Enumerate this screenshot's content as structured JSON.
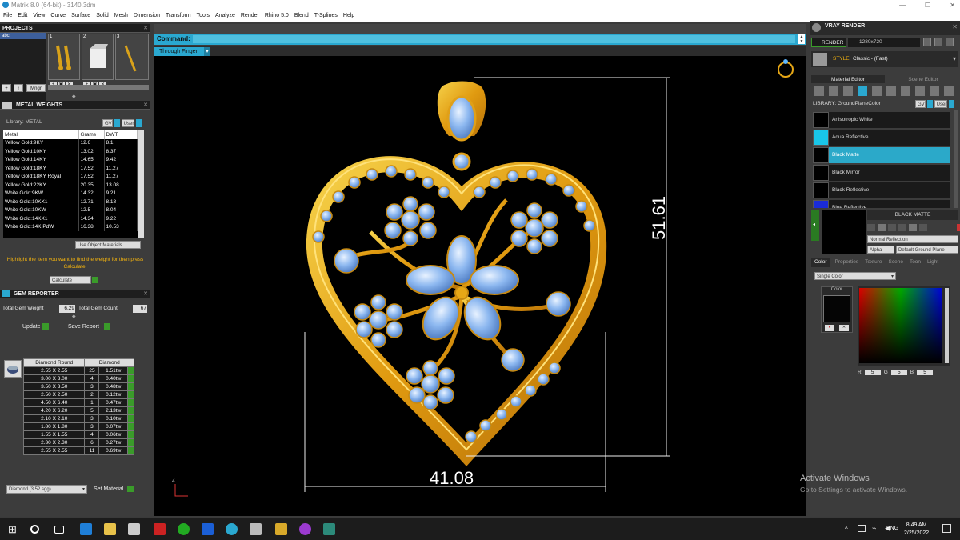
{
  "titlebar": {
    "title": "Matrix 8.0 (64-bit) - 3140.3dm",
    "minimize": "—",
    "maximize": "❐",
    "close": "✕"
  },
  "menu": [
    "File",
    "Edit",
    "View",
    "Curve",
    "Surface",
    "Solid",
    "Mesh",
    "Dimension",
    "Transform",
    "Tools",
    "Analyze",
    "Render",
    "Rhino 5.0",
    "Blend",
    "T-Splines",
    "Help"
  ],
  "projects": {
    "header": "PROJECTS",
    "selected": "abc",
    "thumbs": [
      "1",
      "2",
      "3"
    ],
    "buttons": {
      "plus": "+",
      "up": "↑",
      "manager": "Mngr"
    }
  },
  "metal": {
    "header": "METAL WEIGHTS",
    "library": "Library: METAL",
    "gv": "GV",
    "user": "User",
    "columns": [
      "Metal",
      "Grams",
      "DWT"
    ],
    "rows": [
      [
        "Yellow Gold:9KY",
        "12.6",
        "8.1"
      ],
      [
        "Yellow Gold:10KY",
        "13.02",
        "8.37"
      ],
      [
        "Yellow Gold:14KY",
        "14.65",
        "9.42"
      ],
      [
        "Yellow Gold:18KY",
        "17.52",
        "11.27"
      ],
      [
        "Yellow Gold:18KY Royal",
        "17.52",
        "11.27"
      ],
      [
        "Yellow Gold:22KY",
        "20.35",
        "13.08"
      ],
      [
        "White Gold:9KW",
        "14.32",
        "9.21"
      ],
      [
        "White Gold:10KX1",
        "12.71",
        "8.18"
      ],
      [
        "White Gold:10KW",
        "12.5",
        "8.04"
      ],
      [
        "White Gold:14KX1",
        "14.34",
        "9.22"
      ],
      [
        "White Gold:14K PdW",
        "16.38",
        "10.53"
      ]
    ],
    "use_object": "Use Object Materials",
    "hint": "Highlight the item you want to find the weight for then press Calculate.",
    "calculate": "Calculate"
  },
  "gems": {
    "header": "GEM REPORTER",
    "total_weight_label": "Total Gem Weight",
    "total_weight": "6.29",
    "total_count_label": "Total Gem Count",
    "total_count": "67",
    "update": "Update",
    "save_report": "Save Report",
    "col1": "Diamond Round",
    "col2": "Diamond",
    "rows": [
      [
        "2.55 X 2.55",
        "25",
        "1.51tw"
      ],
      [
        "3.00 X 3.00",
        "4",
        "0.40tw"
      ],
      [
        "3.50 X 3.50",
        "3",
        "0.48tw"
      ],
      [
        "2.50 X 2.50",
        "2",
        "0.12tw"
      ],
      [
        "4.50 X 6.40",
        "1",
        "0.47tw"
      ],
      [
        "4.20 X 6.20",
        "5",
        "2.13tw"
      ],
      [
        "2.10 X 2.10",
        "3",
        "0.10tw"
      ],
      [
        "1.80 X 1.80",
        "3",
        "0.07tw"
      ],
      [
        "1.55 X 1.55",
        "4",
        "0.06tw"
      ],
      [
        "2.30 X 2.30",
        "6",
        "0.27tw"
      ],
      [
        "2.55 X 2.55",
        "11",
        "0.69tw"
      ]
    ],
    "material_select": "Diamond    (3.52 sgg)",
    "set_material": "Set Material"
  },
  "command": {
    "label": "Command:",
    "value": ""
  },
  "viewport": {
    "mode": "Through Finger",
    "dim_height": "51.61",
    "dim_width": "41.08",
    "axis_label": "Z"
  },
  "vray": {
    "header": "VRAY RENDER",
    "render": "RENDER",
    "resolution": "1280x720",
    "style_label": "STYLE",
    "style_value": "Classic - (Fast)",
    "tab_material": "Material Editor",
    "tab_scene": "Scene Editor",
    "library": "LIBRARY: GroundPlaneColor",
    "gv": "GV",
    "user": "User",
    "materials": [
      {
        "name": "Anisotropic White",
        "color": "#111111"
      },
      {
        "name": "Aqua Reflective",
        "color": "#19c6e8"
      },
      {
        "name": "Black Matte",
        "color": "#000000"
      },
      {
        "name": "Black Mirror",
        "color": "#050505"
      },
      {
        "name": "Black Reflective",
        "color": "#0a0a0a"
      },
      {
        "name": "Blue Reflective",
        "color": "#1a2bd8"
      }
    ],
    "selected_material": "BLACK MATTE",
    "normal_reflection": "Normal Reflection",
    "alpha": "Alpha",
    "ground_plane": "Default Ground Plane",
    "subtabs": [
      "Color",
      "Properties",
      "Texture",
      "Scene",
      "Toon",
      "Light"
    ],
    "color_mode": "Single Color",
    "color_label": "Color",
    "r_label": "R",
    "r": "5",
    "g_label": "G",
    "g": "5",
    "b_label": "B",
    "b": "5"
  },
  "watermark": {
    "line1": "Activate Windows",
    "line2": "Go to Settings to activate Windows."
  },
  "taskbar": {
    "lang": "ENG",
    "time": "8:49 AM",
    "date": "2/25/2022"
  },
  "colors": {
    "accent": "#2aa8d0",
    "gold": "#e6a716",
    "gem": "#8db8f0"
  }
}
